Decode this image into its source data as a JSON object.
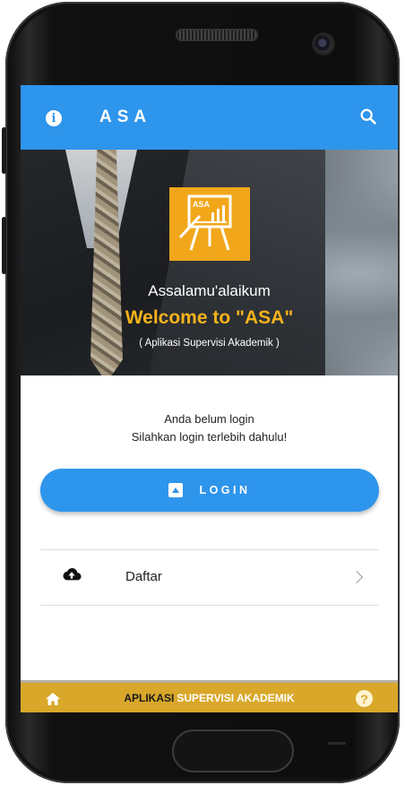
{
  "appbar": {
    "title": "ASA",
    "info_icon": "info-icon",
    "search_icon": "search-icon",
    "color": "#2e95ec"
  },
  "hero": {
    "logo_text": "ASA",
    "greeting": "Assalamu'alaikum",
    "welcome": "Welcome to \"ASA\"",
    "subtitle": "( Aplikasi Supervisi Akademik )",
    "accent": "#f6b21c"
  },
  "notice": {
    "line1": "Anda belum login",
    "line2": "Silahkan login terlebih dahulu!"
  },
  "login_button": {
    "label": "LOGIN",
    "icon": "login-icon"
  },
  "menu": {
    "items": [
      {
        "label": "Daftar",
        "icon": "cloud-upload-icon"
      }
    ]
  },
  "footer": {
    "text_part1": "APLIKASI",
    "text_part2": "SUPERVISI AKADEMIK",
    "home_icon": "home-icon",
    "help_icon": "help-icon",
    "help_glyph": "?",
    "color": "#d9a82a"
  }
}
